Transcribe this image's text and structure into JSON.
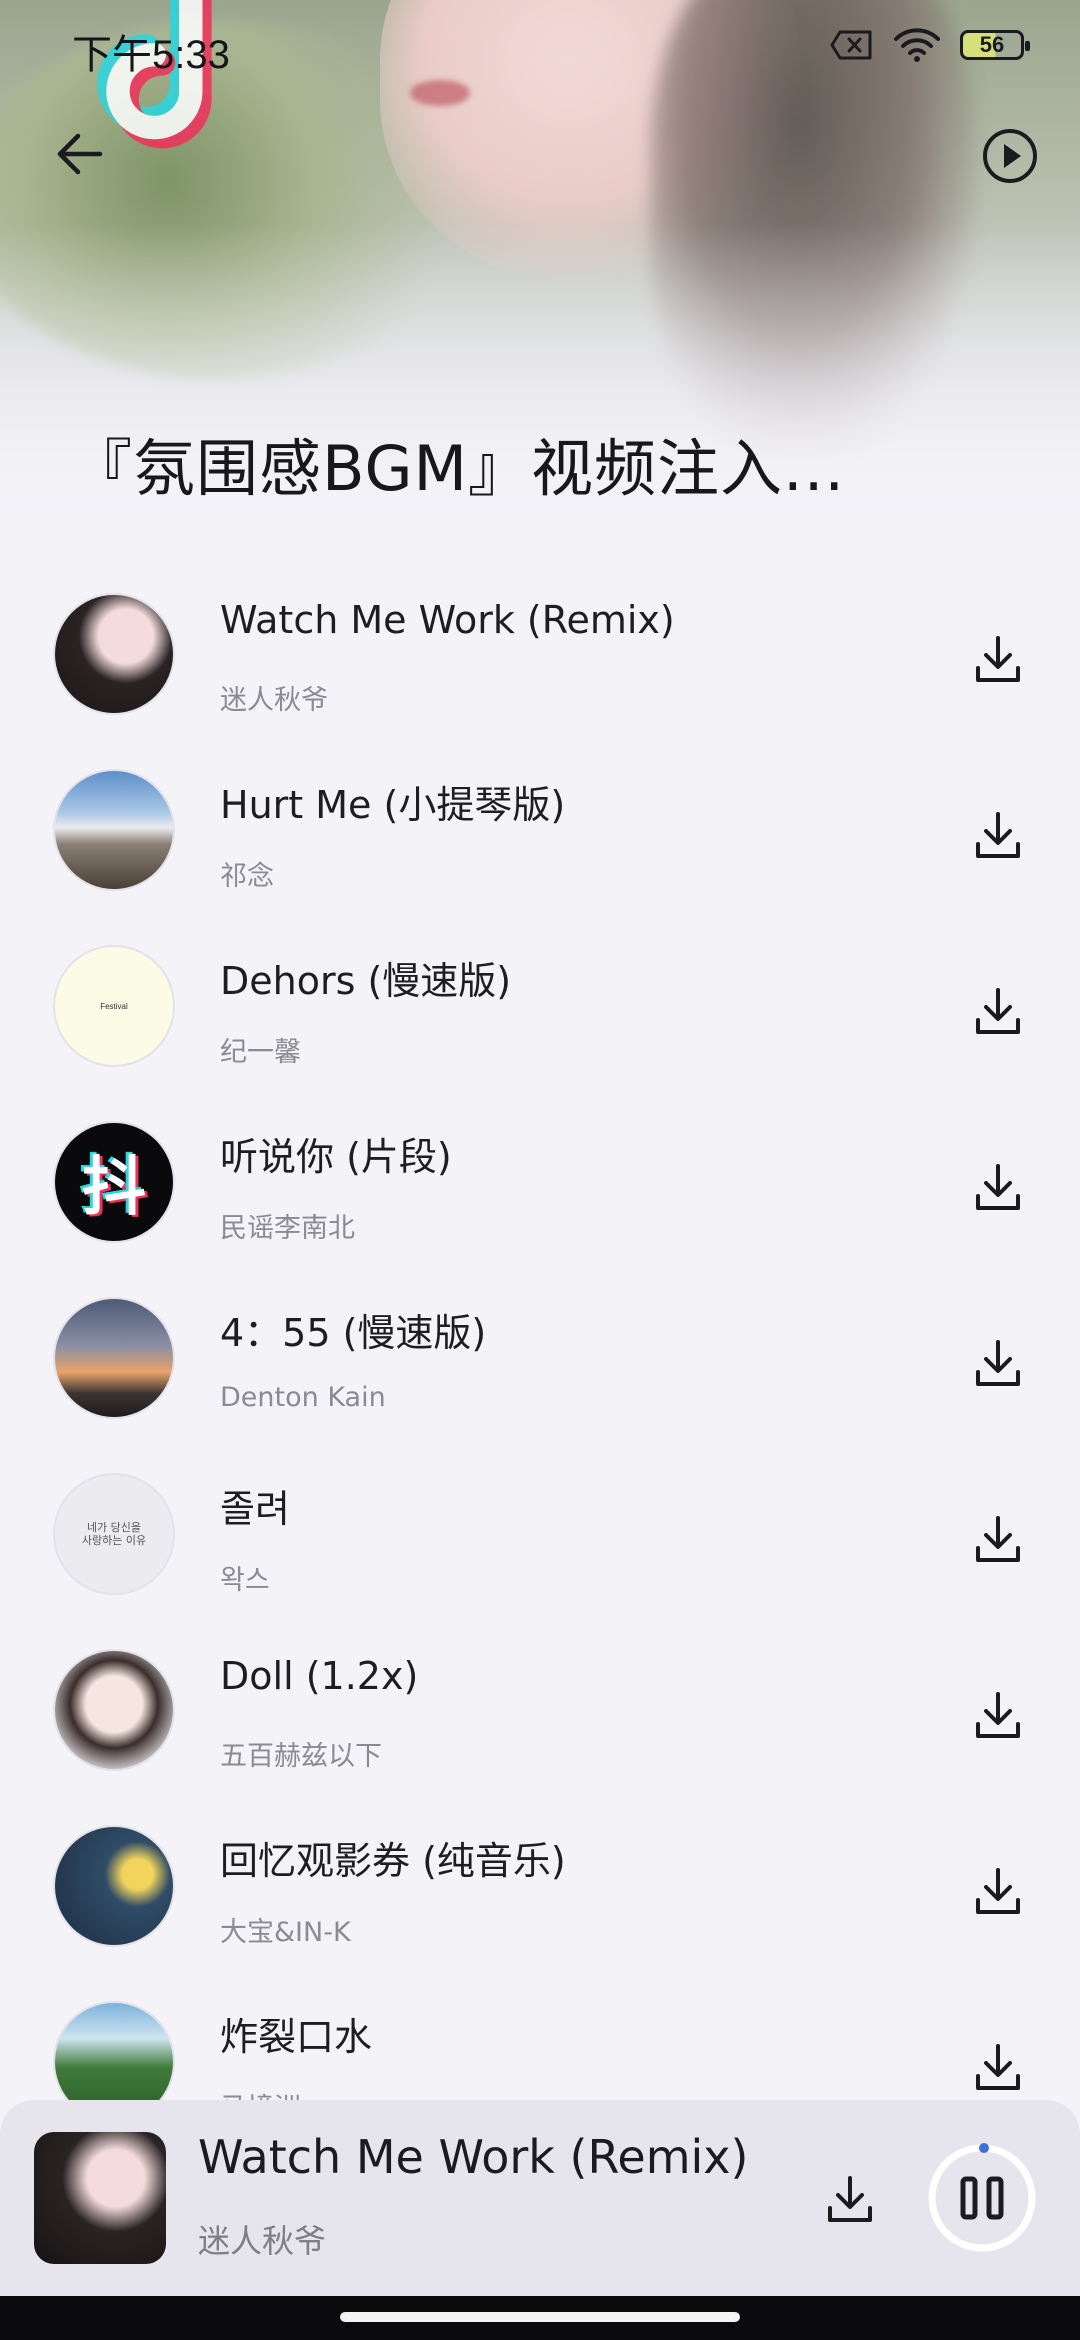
{
  "status_bar": {
    "time": "下午5:33",
    "battery": "56",
    "icons": [
      "sim-off-icon",
      "wifi-icon",
      "battery-icon"
    ]
  },
  "header": {
    "back_icon": "back-arrow-icon",
    "play_all_icon": "play-circle-icon",
    "title": "『氛围感BGM』视频注入..."
  },
  "songs": [
    {
      "title": "Watch Me Work (Remix)",
      "artist": "迷人秋爷"
    },
    {
      "title": "Hurt Me (小提琴版)",
      "artist": "祁念"
    },
    {
      "title": "Dehors (慢速版)",
      "artist": "纪一馨"
    },
    {
      "title": "听说你 (片段)",
      "artist": "民谣李南北"
    },
    {
      "title": "4：55 (慢速版)",
      "artist": "Denton Kain"
    },
    {
      "title": "졸려",
      "artist": "왁스"
    },
    {
      "title": "Doll (1.2x)",
      "artist": "五百赫兹以下"
    },
    {
      "title": "回忆观影券 (纯音乐)",
      "artist": "大宝&IN-K"
    },
    {
      "title": "炸裂口水",
      "artist": "马境洲"
    }
  ],
  "covers": {
    "c3_text": "Festival",
    "c4_text": "抖",
    "c6_text": "네가 당신을\n사랑하는 이유"
  },
  "now_playing": {
    "title": "Watch Me Work (Remix)",
    "artist": "迷人秋爷",
    "download_icon": "download-icon",
    "pause_icon": "pause-icon"
  },
  "colors": {
    "background": "#f4f3f8",
    "player_bar": "#e6e5ee",
    "accent": "#3d6fd4"
  }
}
